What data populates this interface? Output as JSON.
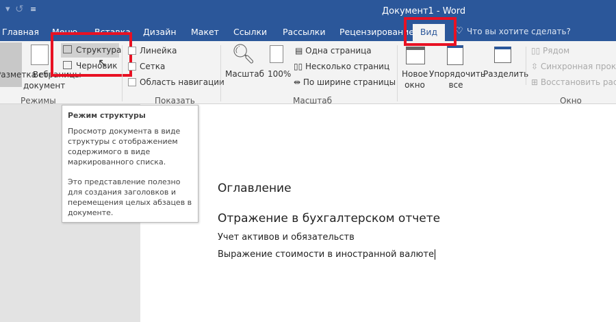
{
  "title": "Документ1 - Word",
  "tabs": [
    "Главная",
    "Меню",
    "Вставка",
    "Дизайн",
    "Макет",
    "Ссылки",
    "Рассылки",
    "Рецензирование",
    "Вид"
  ],
  "search_placeholder": "Что вы хотите сделать?",
  "ribbon": {
    "modes": {
      "layout": "Разметка страницы",
      "web": "Веб-документ",
      "outline": "Структура",
      "draft": "Черновик",
      "group": "Режимы"
    },
    "show": {
      "ruler": "Линейка",
      "grid": "Сетка",
      "nav": "Область навигации",
      "group": "Показать"
    },
    "zoom": {
      "zoom": "Масштаб",
      "pct": "100%",
      "one": "Одна страница",
      "multi": "Несколько страниц",
      "width": "По ширине страницы",
      "group": "Масштаб"
    },
    "window": {
      "new1": "Новое",
      "new2": "окно",
      "arr1": "Упорядочить",
      "arr2": "все",
      "split": "Разделить",
      "side": "Рядом",
      "sync": "Синхронная прокрутка",
      "reset": "Восстановить расположение",
      "group": "Окно"
    }
  },
  "tooltip": {
    "title": "Режим структуры",
    "p1": "Просмотр документа в виде структуры с отображением содержимого в виде маркированного списка.",
    "p2": "Это представление полезно для создания заголовков и перемещения целых абзацев в документе."
  },
  "document": {
    "toc": "Оглавление",
    "h1": "Отражение в бухгалтерском отчете",
    "h2": "Учет активов и обязательств",
    "body": "Выражение стоимости в иностранной валюте"
  },
  "colors": {
    "accent": "#2b579a",
    "highlight": "#e81123"
  }
}
